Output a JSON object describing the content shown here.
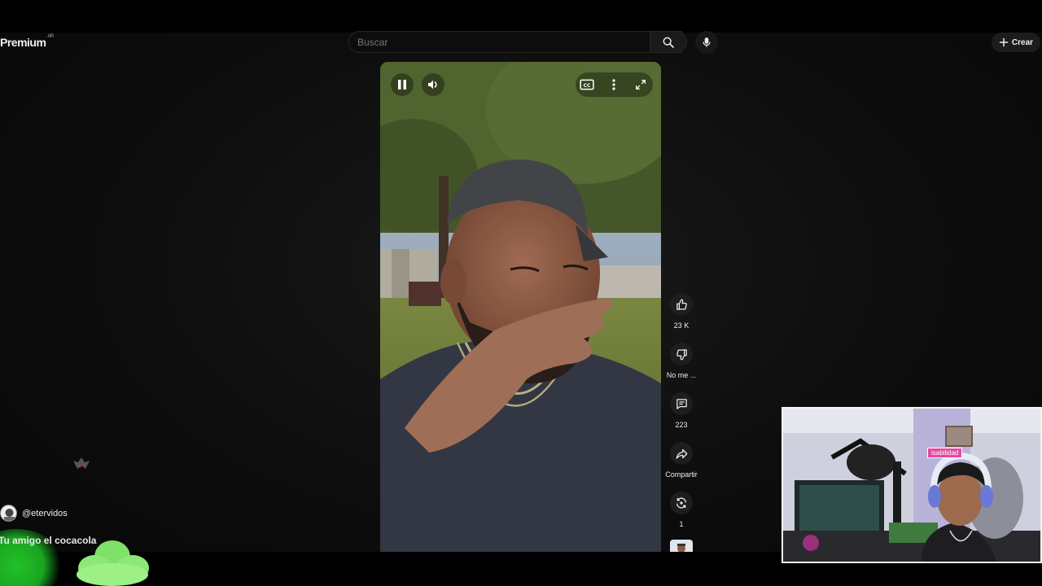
{
  "header": {
    "logo_text": "Premium",
    "logo_region": "AR",
    "search_placeholder": "Buscar",
    "create_label": "Crear"
  },
  "player": {
    "controls": [
      "pause-icon",
      "volume-icon",
      "closed-captions-icon",
      "more-vert-icon",
      "fullscreen-icon"
    ]
  },
  "actions": {
    "like_count": "23 K",
    "dislike_label": "No me ...",
    "comments_count": "223",
    "share_label": "Compartir",
    "remix_count": "1"
  },
  "chat_overlay": {
    "username": "@etervidos",
    "message": "Tu amigo el cocacola"
  },
  "webcam": {
    "banner_text": "isabilidad"
  },
  "colors": {
    "background": "#0f0f0f",
    "chat_glow": "#22c22a",
    "banner": "#e34aa0"
  }
}
